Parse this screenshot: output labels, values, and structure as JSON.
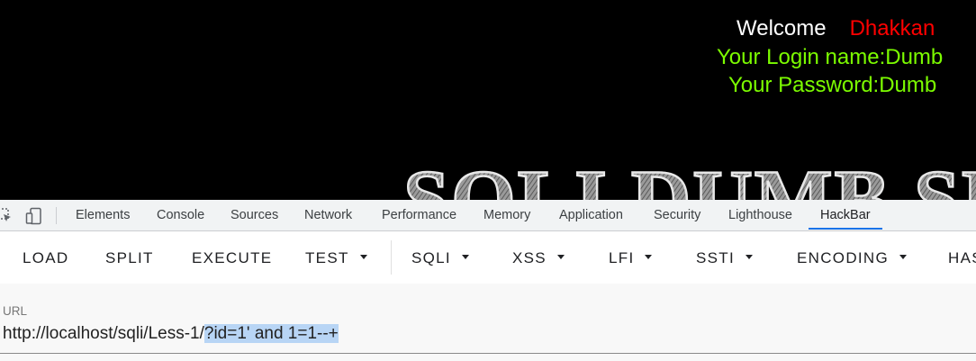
{
  "page": {
    "welcome_word": "Welcome",
    "welcome_user": "Dhakkan",
    "login_line": "Your Login name:Dumb",
    "password_line": "Your Password:Dumb",
    "banner_text": "SQLI DUMB SE",
    "colors": {
      "welcome": "#ffffff",
      "user": "#ff0000",
      "credentials": "#7cfc00",
      "background": "#000000"
    }
  },
  "devtools": {
    "icons": [
      "inspect-element-icon",
      "device-toolbar-icon"
    ],
    "tabs": [
      "Elements",
      "Console",
      "Sources",
      "Network",
      "Performance",
      "Memory",
      "Application",
      "Security",
      "Lighthouse",
      "HackBar"
    ],
    "active_tab": "HackBar",
    "accent": "#1a73e8"
  },
  "hackbar": {
    "buttons": [
      "LOAD",
      "SPLIT",
      "EXECUTE"
    ],
    "dropdowns": [
      "TEST",
      "SQLI",
      "XSS",
      "LFI",
      "SSTI",
      "ENCODING",
      "HAS"
    ]
  },
  "url": {
    "label": "URL",
    "value_plain": "http://localhost/sqli/Less-1/",
    "value_selected": "?id=1' and 1=1--+"
  }
}
